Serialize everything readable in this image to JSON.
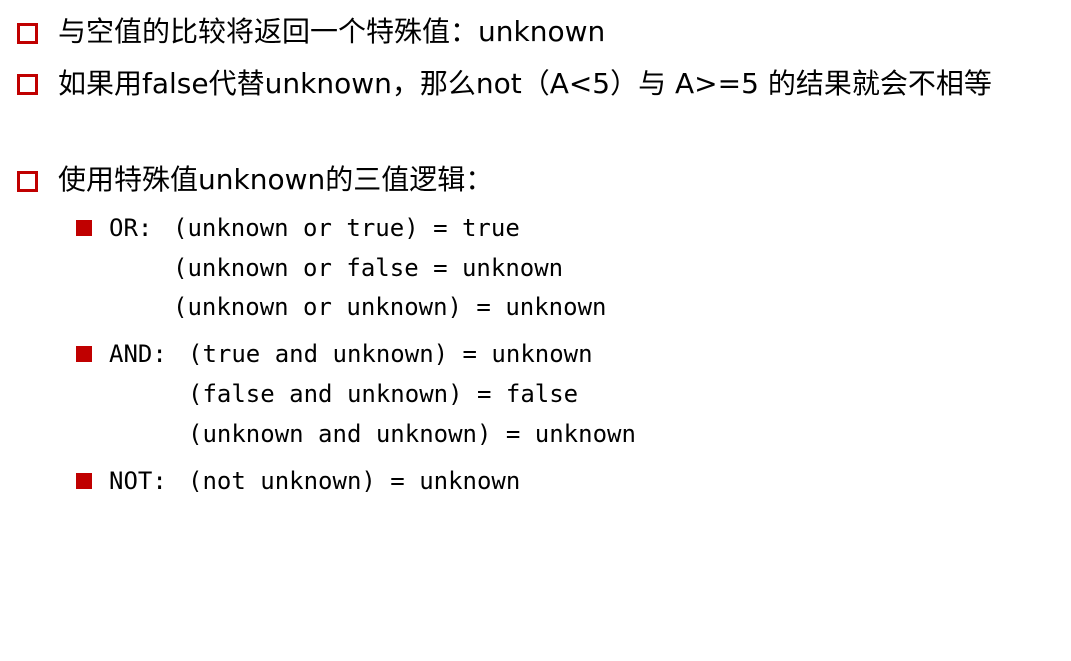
{
  "bullets": [
    {
      "text": "与空值的比较将返回一个特殊值：unknown"
    },
    {
      "text": "如果用false代替unknown，那么not（A<5）与 A>=5 的结果就会不相等"
    },
    {
      "text": "使用特殊值unknown的三值逻辑："
    }
  ],
  "logic": [
    {
      "label": "OR:",
      "lines": [
        "(unknown or true) = true",
        "(unknown or false = unknown",
        "(unknown or unknown) = unknown"
      ]
    },
    {
      "label": "AND:",
      "lines": [
        "(true and unknown) = unknown",
        "(false and unknown) = false",
        "(unknown and unknown) = unknown"
      ]
    },
    {
      "label": "NOT:",
      "lines": [
        "(not unknown) = unknown"
      ]
    }
  ],
  "colors": {
    "accent": "#c00000",
    "text": "#000000",
    "background": "#ffffff"
  }
}
